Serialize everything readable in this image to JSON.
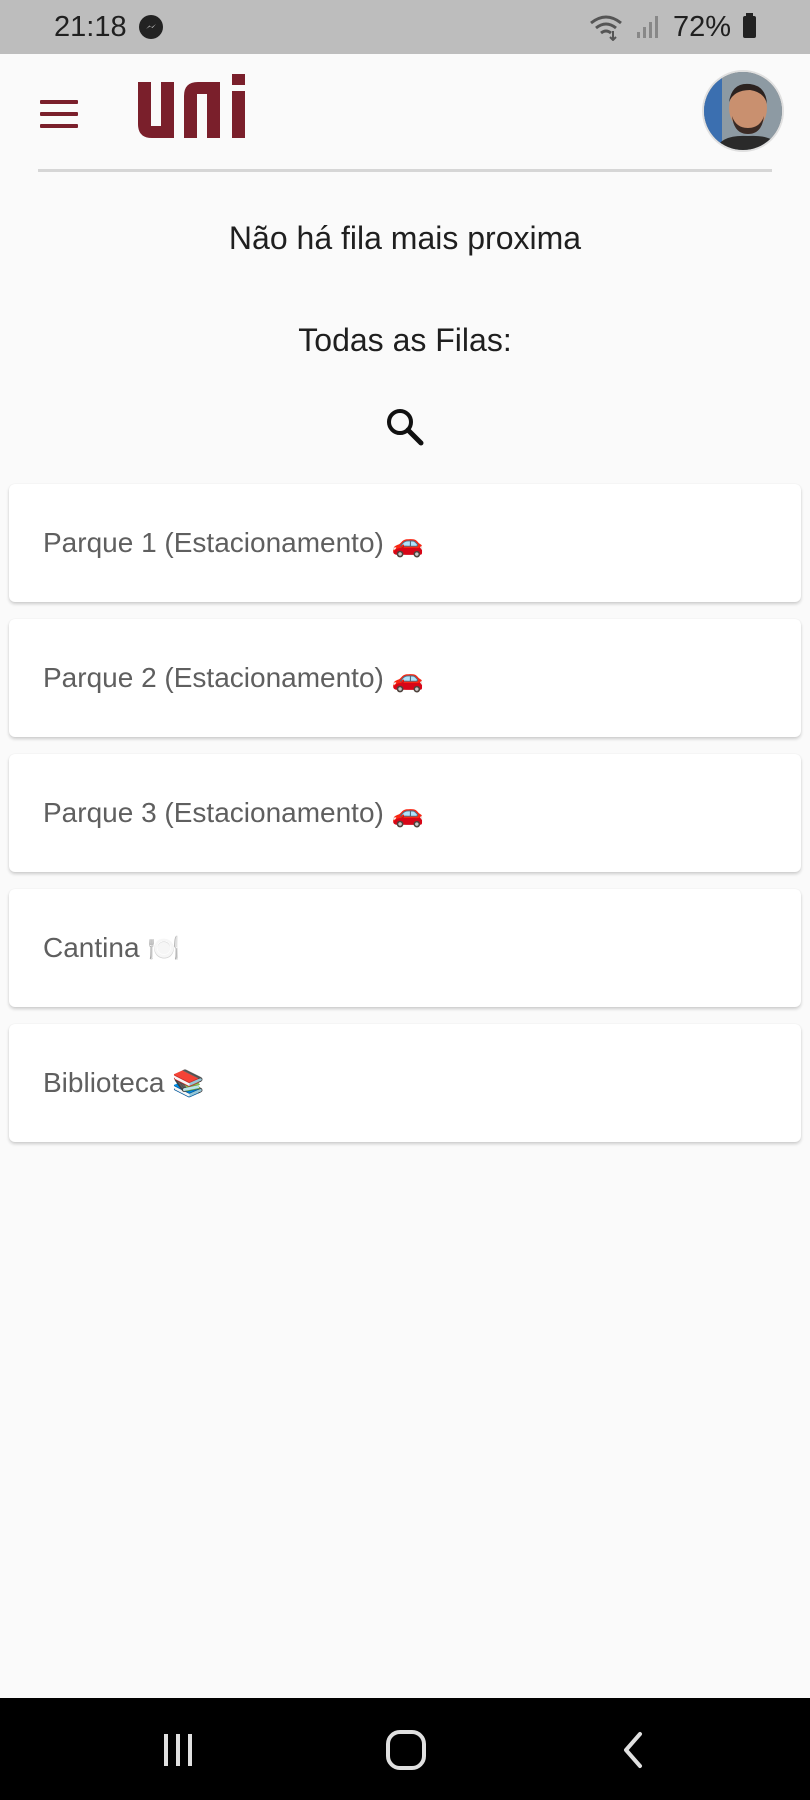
{
  "status_bar": {
    "time": "21:18",
    "battery": "72%",
    "icons": [
      "messenger-icon",
      "wifi-icon",
      "signal-icon",
      "battery-icon"
    ]
  },
  "header": {
    "logo_text": "uni",
    "brand_color": "#7a1f2b",
    "icons": [
      "menu-icon",
      "avatar"
    ]
  },
  "main": {
    "nearest_queue_text": "Não há fila mais proxima",
    "all_queues_title": "Todas as Filas:",
    "search_icon": "search-icon",
    "queues": [
      {
        "label": "Parque 1 (Estacionamento)",
        "emoji": "🚗"
      },
      {
        "label": "Parque 2 (Estacionamento)",
        "emoji": "🚗"
      },
      {
        "label": "Parque 3 (Estacionamento)",
        "emoji": "🚗"
      },
      {
        "label": "Cantina",
        "emoji": "🍽️"
      },
      {
        "label": "Biblioteca",
        "emoji": "📚"
      }
    ]
  },
  "nav_bar": {
    "icons": [
      "recents-icon",
      "home-icon",
      "back-icon"
    ]
  }
}
